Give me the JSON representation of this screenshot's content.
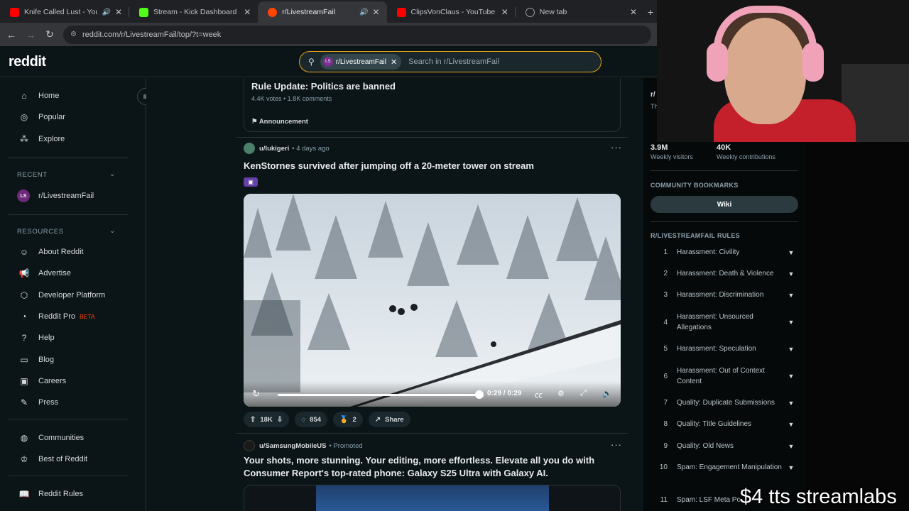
{
  "browser": {
    "tabs": [
      {
        "title": "Knife Called Lust - YouTube",
        "favicon": "youtube-icon",
        "audio": true,
        "active": false
      },
      {
        "title": "Stream - Kick Dashboard",
        "favicon": "kick-icon",
        "audio": false,
        "active": false
      },
      {
        "title": "r/LivestreamFail",
        "favicon": "reddit-icon",
        "audio": true,
        "active": true
      },
      {
        "title": "ClipsVonClaus - YouTube",
        "favicon": "youtube-icon",
        "audio": false,
        "active": false
      },
      {
        "title": "New tab",
        "favicon": "globe-icon",
        "audio": false,
        "active": false
      }
    ],
    "url": "reddit.com/r/LivestreamFail/top/?t=week"
  },
  "header": {
    "logo": "reddit",
    "search_chip": "r/LivestreamFail",
    "search_chip_avatar": "LS",
    "search_placeholder": "Search in r/LivestreamFail"
  },
  "sidebar": {
    "nav": [
      {
        "label": "Home",
        "icon": "home-icon"
      },
      {
        "label": "Popular",
        "icon": "popular-icon"
      },
      {
        "label": "Explore",
        "icon": "explore-icon"
      }
    ],
    "recent_header": "RECENT",
    "recent": [
      {
        "label": "r/LivestreamFail",
        "avatar": "LS"
      }
    ],
    "resources_header": "RESOURCES",
    "resources": [
      {
        "label": "About Reddit",
        "icon": "reddit-alien-icon"
      },
      {
        "label": "Advertise",
        "icon": "megaphone-icon"
      },
      {
        "label": "Developer Platform",
        "icon": "dev-platform-icon"
      },
      {
        "label": "Reddit Pro",
        "icon": "reddit-pro-icon",
        "badge": "BETA"
      },
      {
        "label": "Help",
        "icon": "help-icon"
      },
      {
        "label": "Blog",
        "icon": "blog-icon"
      },
      {
        "label": "Careers",
        "icon": "careers-icon"
      },
      {
        "label": "Press",
        "icon": "press-icon"
      }
    ],
    "bottom": [
      {
        "label": "Communities",
        "icon": "communities-icon"
      },
      {
        "label": "Best of Reddit",
        "icon": "best-of-reddit-icon"
      }
    ],
    "rules_link": "Reddit Rules"
  },
  "feed": {
    "pinned": {
      "title": "Rule Update: Politics are banned",
      "meta": "4.4K votes • 1.8K comments",
      "flair": "Announcement"
    },
    "post": {
      "user": "u/lukigeri",
      "age": "• 4 days ago",
      "title": "KenStornes survived after jumping off a 20-meter tower on stream",
      "video_time": "0:29 / 0:29",
      "video_progress": 1.0,
      "votes": "18K",
      "comments": "854",
      "awards": "2",
      "share": "Share"
    },
    "promo": {
      "user": "u/SamsungMobileUS",
      "tag": "• Promoted",
      "title": "Your shots, more stunning. Your editing, more effortless. Elevate all you do with Consumer Report's top-rated phone: Galaxy S25 Ultra with Galaxy AI."
    }
  },
  "right_sidebar": {
    "partial_name": "r/",
    "partial_line": "Th",
    "stats": [
      {
        "value": "3.9M",
        "label": "Weekly visitors"
      },
      {
        "value": "40K",
        "label": "Weekly contributions"
      }
    ],
    "bookmarks_header": "COMMUNITY BOOKMARKS",
    "wiki": "Wiki",
    "rules_header": "R/LIVESTREAMFAIL RULES",
    "rules": [
      {
        "n": "1",
        "text": "Harassment: Civility"
      },
      {
        "n": "2",
        "text": "Harassment: Death & Violence"
      },
      {
        "n": "3",
        "text": "Harassment: Discrimination"
      },
      {
        "n": "4",
        "text": "Harassment: Unsourced Allegations"
      },
      {
        "n": "5",
        "text": "Harassment: Speculation"
      },
      {
        "n": "6",
        "text": "Harassment: Out of Context Content"
      },
      {
        "n": "7",
        "text": "Quality: Duplicate Submissions"
      },
      {
        "n": "8",
        "text": "Quality: Title Guidelines"
      },
      {
        "n": "9",
        "text": "Quality: Old News"
      },
      {
        "n": "10",
        "text": "Spam: Engagement Manipulation"
      },
      {
        "n": "11",
        "text": "Spam: LSF Meta Po"
      }
    ]
  },
  "overlay": {
    "tts": "$4 tts streamlabs"
  },
  "colors": {
    "reddit_bg": "#0b1416",
    "search_border": "#e8a317",
    "twitch_purple": "#6441a5",
    "beta": "#ff4500"
  }
}
